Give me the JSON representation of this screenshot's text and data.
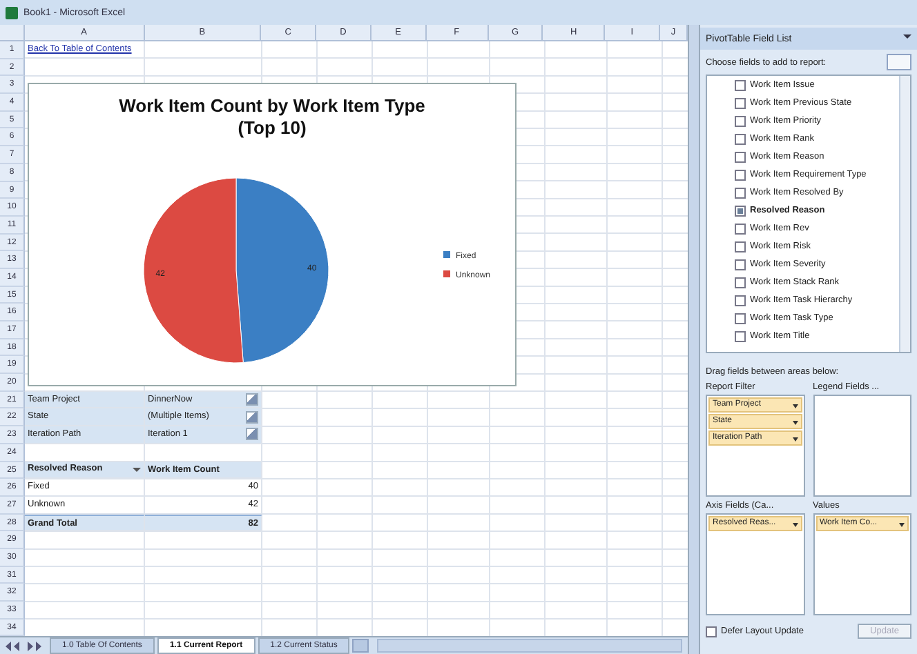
{
  "window": {
    "title": "Book1 - Microsoft Excel"
  },
  "columns": [
    "A",
    "B",
    "C",
    "D",
    "E",
    "F",
    "G",
    "H",
    "I",
    "J"
  ],
  "rows": [
    "1",
    "2",
    "3",
    "4",
    "5",
    "6",
    "7",
    "8",
    "9",
    "10",
    "11",
    "12",
    "13",
    "14",
    "15",
    "16",
    "17",
    "18",
    "19",
    "20",
    "21",
    "22",
    "23",
    "24",
    "25",
    "26",
    "27",
    "28",
    "29",
    "30",
    "31",
    "32",
    "33",
    "34"
  ],
  "link": "Back To Table of Contents",
  "chart": {
    "chart_data": {
      "type": "pie",
      "title": "Work Item Count by Work Item Type (Top 10)",
      "categories": [
        "Fixed",
        "Unknown"
      ],
      "values": [
        40,
        42
      ],
      "data_labels": true,
      "legend": "right"
    }
  },
  "filters": [
    {
      "field": "Team Project",
      "value": "DinnerNow"
    },
    {
      "field": "State",
      "value": "(Multiple Items)"
    },
    {
      "field": "Iteration Path",
      "value": "Iteration 1"
    }
  ],
  "pivot": {
    "row_header": "Resolved Reason",
    "value_header": "Work Item Count",
    "rows": [
      {
        "label": "Fixed",
        "value": "40"
      },
      {
        "label": "Unknown",
        "value": "42"
      }
    ],
    "total": {
      "label": "Grand Total",
      "value": "82"
    }
  },
  "field_list": {
    "title": "PivotTable Field List",
    "prompt": "Choose fields to add to report:",
    "fields": [
      {
        "label": "Work Item Issue",
        "checked": false
      },
      {
        "label": "Work Item Previous State",
        "checked": false
      },
      {
        "label": "Work Item Priority",
        "checked": false
      },
      {
        "label": "Work Item Rank",
        "checked": false
      },
      {
        "label": "Work Item Reason",
        "checked": false
      },
      {
        "label": "Work Item Requirement Type",
        "checked": false
      },
      {
        "label": "Work Item Resolved By",
        "checked": false
      },
      {
        "label": "Resolved Reason",
        "checked": true
      },
      {
        "label": "Work Item Rev",
        "checked": false
      },
      {
        "label": "Work Item Risk",
        "checked": false
      },
      {
        "label": "Work Item Severity",
        "checked": false
      },
      {
        "label": "Work Item Stack Rank",
        "checked": false
      },
      {
        "label": "Work Item Task Hierarchy",
        "checked": false
      },
      {
        "label": "Work Item Task Type",
        "checked": false
      },
      {
        "label": "Work Item Title",
        "checked": false
      }
    ],
    "drag_hint": "Drag fields between areas below:",
    "areas": [
      {
        "title": "Report Filter",
        "items": [
          "Team Project",
          "State",
          "Iteration Path"
        ]
      },
      {
        "title": "Legend Fields ..."
      },
      {
        "title": "Axis Fields (Ca...",
        "items": [
          "Resolved Reas..."
        ]
      },
      {
        "title": "Values",
        "items": [
          "Work Item Co..."
        ]
      }
    ],
    "defer": {
      "label": "Defer Layout Update",
      "checked": false
    },
    "update": {
      "label": "Update",
      "disabled": true
    }
  },
  "sheet_tabs": [
    {
      "label": "1.0 Table Of Contents",
      "selected": false
    },
    {
      "label": "1.1 Current Report",
      "selected": true
    },
    {
      "label": "1.2 Current Status",
      "selected": false
    }
  ]
}
